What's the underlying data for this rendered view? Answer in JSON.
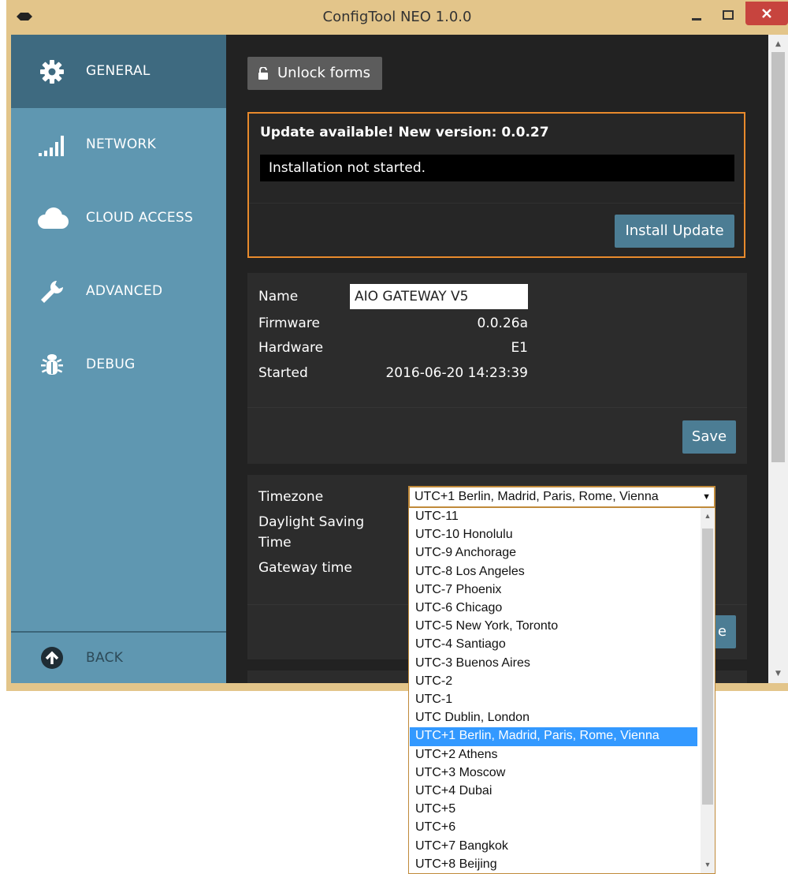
{
  "window": {
    "title": "ConfigTool NEO 1.0.0"
  },
  "sidebar": {
    "items": [
      {
        "label": "GENERAL",
        "icon": "gear-icon",
        "active": true
      },
      {
        "label": "NETWORK",
        "icon": "signal-bars-icon",
        "active": false
      },
      {
        "label": "CLOUD ACCESS",
        "icon": "cloud-icon",
        "active": false
      },
      {
        "label": "ADVANCED",
        "icon": "wrench-icon",
        "active": false
      },
      {
        "label": "DEBUG",
        "icon": "bug-icon",
        "active": false
      }
    ],
    "back_label": "BACK"
  },
  "toolbar": {
    "unlock_label": "Unlock forms"
  },
  "update": {
    "title": "Update available! New version: 0.0.27",
    "status": "Installation not started.",
    "install_label": "Install Update"
  },
  "device": {
    "name_label": "Name",
    "name_value": "AIO GATEWAY V5",
    "firmware_label": "Firmware",
    "firmware_value": "0.0.26a",
    "hardware_label": "Hardware",
    "hardware_value": "E1",
    "started_label": "Started",
    "started_value": "2016-06-20 14:23:39",
    "save_label": "Save"
  },
  "time": {
    "timezone_label": "Timezone",
    "dst_label_line1": "Daylight Saving",
    "dst_label_line2": "Time",
    "gateway_time_label": "Gateway time",
    "save_label_partial": "e",
    "selected": "UTC+1  Berlin, Madrid, Paris, Rome, Vienna",
    "options": [
      "UTC-11",
      "UTC-10  Honolulu",
      "UTC-9  Anchorage",
      "UTC-8  Los Angeles",
      "UTC-7  Phoenix",
      "UTC-6  Chicago",
      "UTC-5  New York, Toronto",
      "UTC-4  Santiago",
      "UTC-3  Buenos Aires",
      "UTC-2",
      "UTC-1",
      "UTC  Dublin, London",
      "UTC+1  Berlin, Madrid, Paris, Rome, Vienna",
      "UTC+2  Athens",
      "UTC+3  Moscow",
      "UTC+4  Dubai",
      "UTC+5",
      "UTC+6",
      "UTC+7  Bangkok",
      "UTC+8  Beijing"
    ],
    "selected_index": 12
  },
  "colors": {
    "accent": "#4c7d94",
    "sidebar": "#5f97b1",
    "sidebar_active": "#3e6a80",
    "update_border": "#e88a2c",
    "selection": "#3399ff"
  }
}
